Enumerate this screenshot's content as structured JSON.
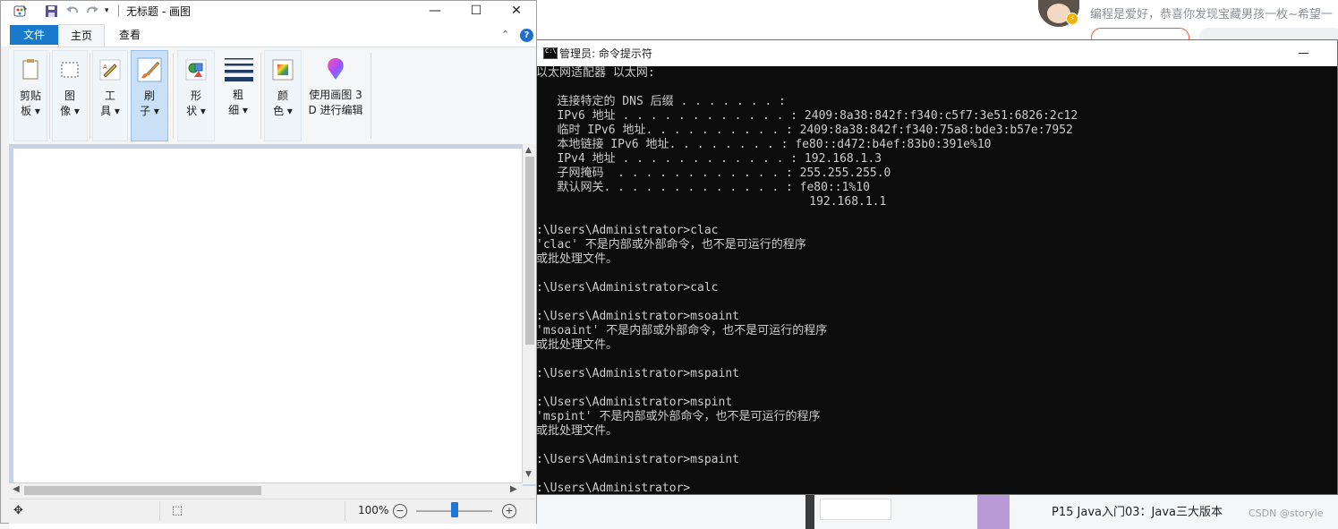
{
  "background": {
    "greeting": "编程是爱好，恭喜你发现宝藏男孩一枚~希望一",
    "article_title": "P15   Java入门03：Java三大版本",
    "watermark": "CSDN @storyle"
  },
  "cmd": {
    "title": "管理员: 命令提示符",
    "icon_text": "C:\\",
    "lines": [
      "以太网适配器 以太网:",
      "",
      "   连接特定的 DNS 后缀 . . . . . . . :",
      "   IPv6 地址 . . . . . . . . . . . . : 2409:8a38:842f:f340:c5f7:3e51:6826:2c12",
      "   临时 IPv6 地址. . . . . . . . . . : 2409:8a38:842f:f340:75a8:bde3:b57e:7952",
      "   本地链接 IPv6 地址. . . . . . . . : fe80::d472:b4ef:83b0:391e%10",
      "   IPv4 地址 . . . . . . . . . . . . : 192.168.1.3",
      "   子网掩码  . . . . . . . . . . . . : 255.255.255.0",
      "   默认网关. . . . . . . . . . . . . : fe80::1%10",
      "                                       192.168.1.1",
      "",
      ":\\Users\\Administrator>clac",
      "'clac' 不是内部或外部命令，也不是可运行的程序",
      "或批处理文件。",
      "",
      ":\\Users\\Administrator>calc",
      "",
      ":\\Users\\Administrator>msoaint",
      "'msoaint' 不是内部或外部命令，也不是可运行的程序",
      "或批处理文件。",
      "",
      ":\\Users\\Administrator>mspaint",
      "",
      ":\\Users\\Administrator>mspint",
      "'mspint' 不是内部或外部命令，也不是可运行的程序",
      "或批处理文件。",
      "",
      ":\\Users\\Administrator>mspaint",
      "",
      ":\\Users\\Administrator>"
    ]
  },
  "paint": {
    "title": "无标题 - 画图",
    "qa_menu": "▾",
    "window_buttons": {
      "minimize": "—",
      "maximize": "☐",
      "close": "✕"
    },
    "tabs": {
      "file": "文件",
      "home": "主页",
      "view": "查看"
    },
    "collapse": "⌃",
    "help": "?",
    "groups": [
      {
        "key": "clipboard",
        "label": "剪贴\n板 ▾",
        "icon": "clipboard-icon"
      },
      {
        "key": "image",
        "label": "图\n像 ▾",
        "icon": "select-icon"
      },
      {
        "key": "tools",
        "label": "工\n具 ▾",
        "icon": "pencil-icon"
      },
      {
        "key": "brushes",
        "label": "刷\n子 ▾",
        "icon": "brush-icon"
      },
      {
        "key": "shapes",
        "label": "形\n状 ▾",
        "icon": "shapes-icon"
      },
      {
        "key": "size",
        "label": "粗\n细 ▾",
        "icon": "line-size-icon"
      },
      {
        "key": "colors",
        "label": "颜\n色 ▾",
        "icon": "color-palette-icon"
      },
      {
        "key": "paint3d",
        "label": "使用画图 3\nD 进行编辑",
        "icon": "paint3d-icon"
      }
    ],
    "status": {
      "zoom": "100%",
      "zoom_level_percent": 100,
      "zoom_out": "−",
      "zoom_in": "+"
    },
    "colors": {
      "file_tab": "#1979ca",
      "selected_group": "#c9e0f7",
      "canvas_backdrop": "#c7d3e4",
      "zoom_thumb": "#1e78d7"
    }
  }
}
